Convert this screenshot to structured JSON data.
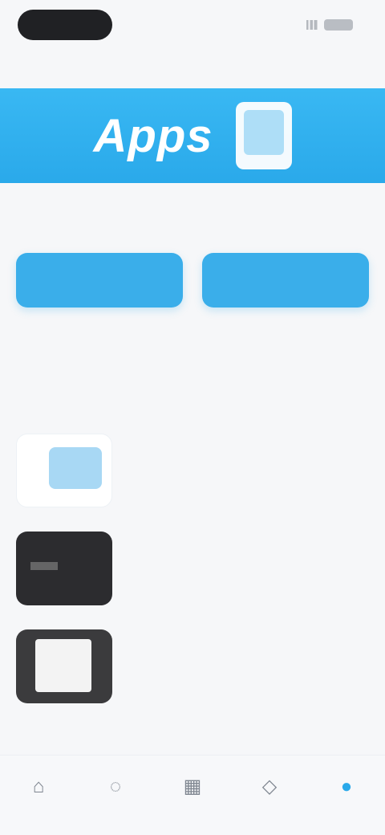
{
  "status": {
    "time": "",
    "signal_icon": "signal-icon",
    "battery_icon": "battery-icon"
  },
  "navigation": {
    "title": ""
  },
  "banner": {
    "text": "Apps",
    "icon": "phone-icon"
  },
  "description": {
    "text": ""
  },
  "actions": {
    "primary_label": "",
    "secondary_label": ""
  },
  "section": {
    "title": "",
    "subtitle": ""
  },
  "features": {
    "title": "",
    "items": [
      {
        "title": "",
        "desc": ""
      },
      {
        "title": "",
        "desc": ""
      },
      {
        "title": "",
        "desc": ""
      }
    ]
  },
  "tabs": [
    {
      "label": "",
      "icon": "home-icon"
    },
    {
      "label": "",
      "icon": "bell-icon"
    },
    {
      "label": "",
      "icon": "grid-icon"
    },
    {
      "label": "",
      "icon": "chat-icon"
    },
    {
      "label": "",
      "icon": "person-icon"
    }
  ],
  "colors": {
    "accent": "#2aa9ea",
    "banner": "#39b8f3",
    "background": "#f6f7f9"
  }
}
